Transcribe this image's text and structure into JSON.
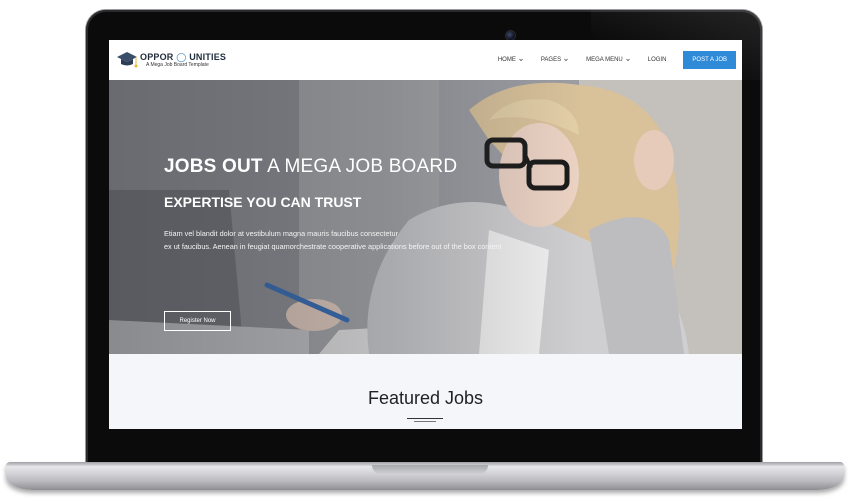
{
  "logo": {
    "title_part1": "OPPOR",
    "title_part2": "UNITIES",
    "subtitle": "A Mega Job Board Template"
  },
  "nav": {
    "items": [
      {
        "label": "HOME",
        "has_dropdown": true
      },
      {
        "label": "PAGES",
        "has_dropdown": true
      },
      {
        "label": "MEGA MENU",
        "has_dropdown": true
      },
      {
        "label": "LOGIN",
        "has_dropdown": false
      }
    ],
    "post_job_label": "POST A JOB"
  },
  "hero": {
    "title_bold": "JOBS OUT",
    "title_light": "A MEGA JOB BOARD",
    "subtitle": "EXPERTISE YOU CAN TRUST",
    "text_line1": "Etiam vel blandit dolor at vestibulum magna mauris faucibus consectetur",
    "text_line2": "ex ut faucibus. Aenean in feugiat quamorchestrate cooperative applications before out of the box content",
    "register_label": "Register Now"
  },
  "featured": {
    "title": "Featured Jobs"
  },
  "colors": {
    "accent": "#2f8ad8",
    "logo_blue": "#2f7ec2",
    "featured_bg": "#f4f6f9"
  }
}
